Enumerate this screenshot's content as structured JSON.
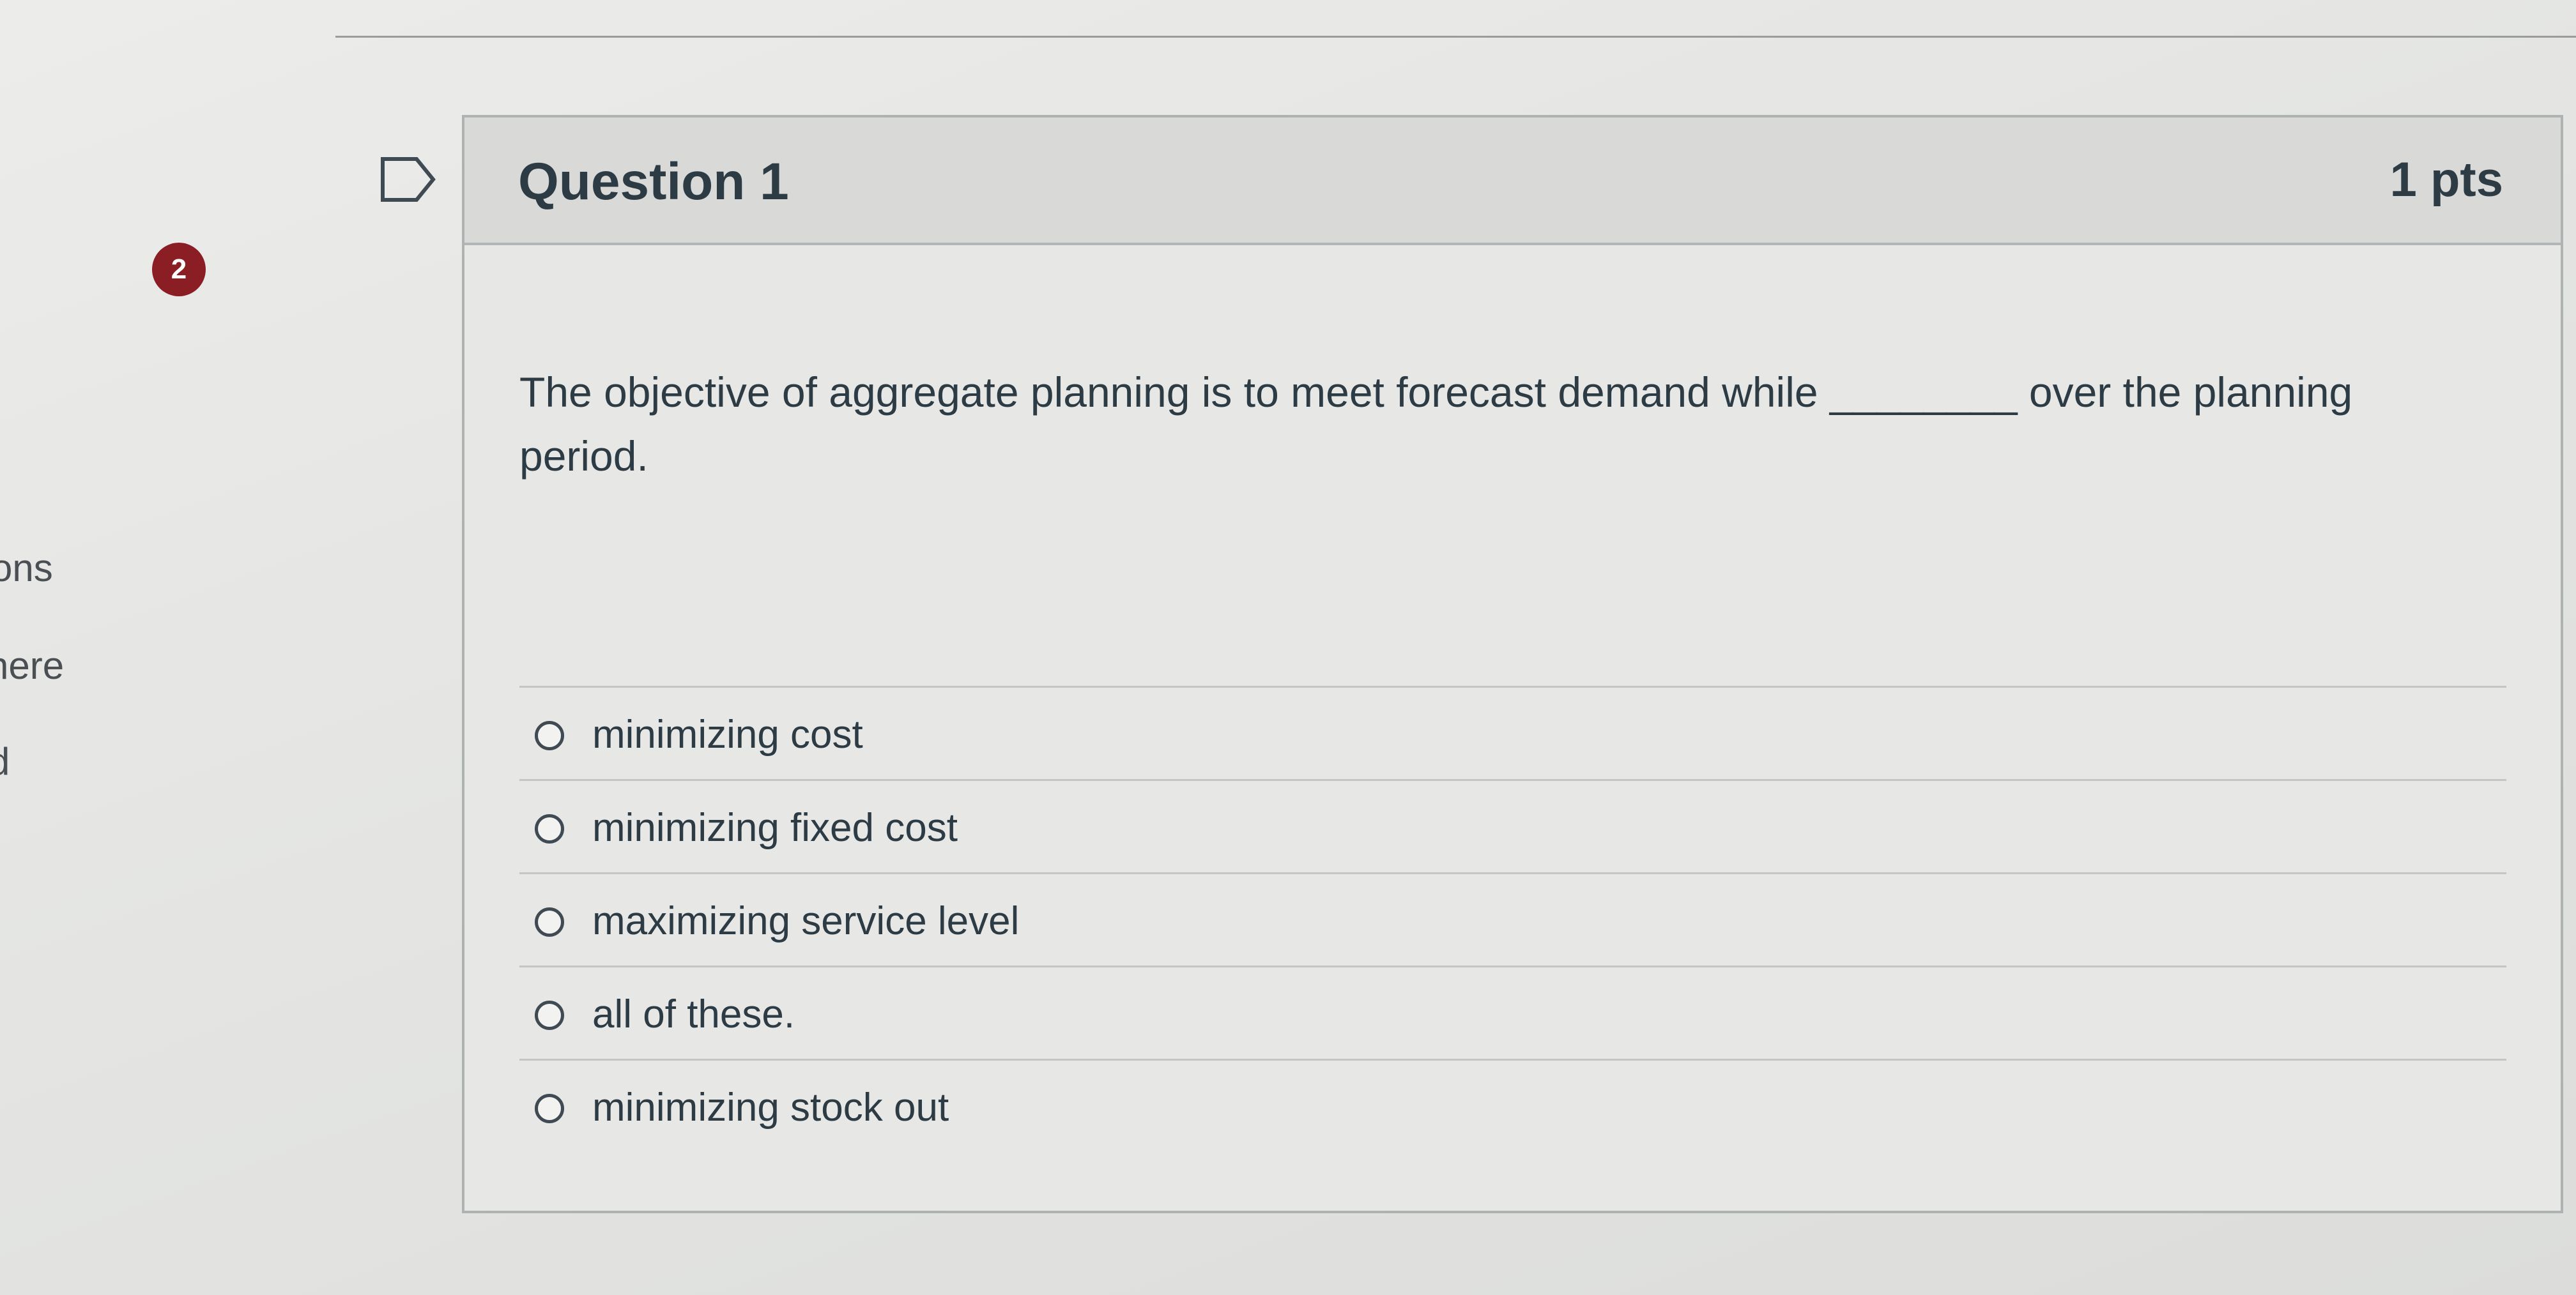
{
  "left_nav": {
    "items": [
      {
        "label": "ons"
      },
      {
        "label": "here"
      },
      {
        "label": "d"
      }
    ],
    "badge_count": "2"
  },
  "question": {
    "title": "Question 1",
    "points": "1 pts",
    "text": "The objective of aggregate planning is to meet forecast demand while ________ over the planning period.",
    "flag_icon": "flag-outline-icon",
    "answers": [
      {
        "label": "minimizing cost",
        "selected": false
      },
      {
        "label": "minimizing fixed cost",
        "selected": false
      },
      {
        "label": "maximizing service level",
        "selected": false
      },
      {
        "label": "all of these.",
        "selected": false
      },
      {
        "label": "minimizing stock out",
        "selected": false
      }
    ]
  },
  "colors": {
    "badge": "#8b1e24",
    "text": "#2d3b45",
    "header_bg": "#d9dad8"
  }
}
